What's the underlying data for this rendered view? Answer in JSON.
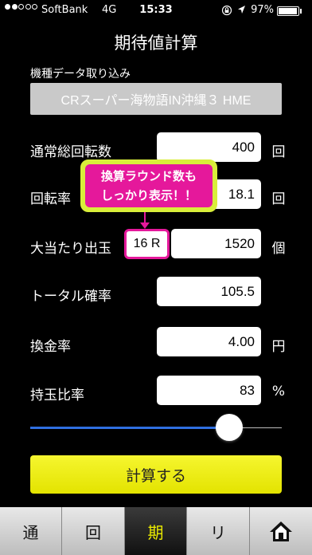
{
  "status": {
    "carrier": "SoftBank",
    "network": "4G",
    "time": "15:33",
    "battery": "97%",
    "battery_level": 0.97,
    "signal_bars": 2
  },
  "title": "期待値計算",
  "machine": {
    "label": "機種データ取り込み",
    "value": "CRスーパー海物語IN沖縄３ HME"
  },
  "rows": [
    {
      "label": "通常総回転数",
      "value": "400",
      "unit": "回"
    },
    {
      "label": "回転率",
      "value": "18.1",
      "unit": "回"
    },
    {
      "label": "大当たり出玉",
      "value": "1520",
      "unit": "個"
    },
    {
      "label": "トータル確率",
      "value": "105.5",
      "unit": ""
    },
    {
      "label": "換金率",
      "value": "4.00",
      "unit": "円"
    },
    {
      "label": "持玉比率",
      "value": "83",
      "unit": "%"
    }
  ],
  "callout": {
    "line1": "換算ラウンド数も",
    "line2": "しっかり表示！！"
  },
  "round_badge": "16 R",
  "slider": {
    "value_percent": 80
  },
  "calc_button": "計算する",
  "tabs": [
    "通",
    "回",
    "期",
    "リ"
  ],
  "active_tab": 2,
  "colors": {
    "accent_yellow": "#e9e900",
    "callout_pink": "#e5189b",
    "slider_blue": "#2f6fe0"
  }
}
